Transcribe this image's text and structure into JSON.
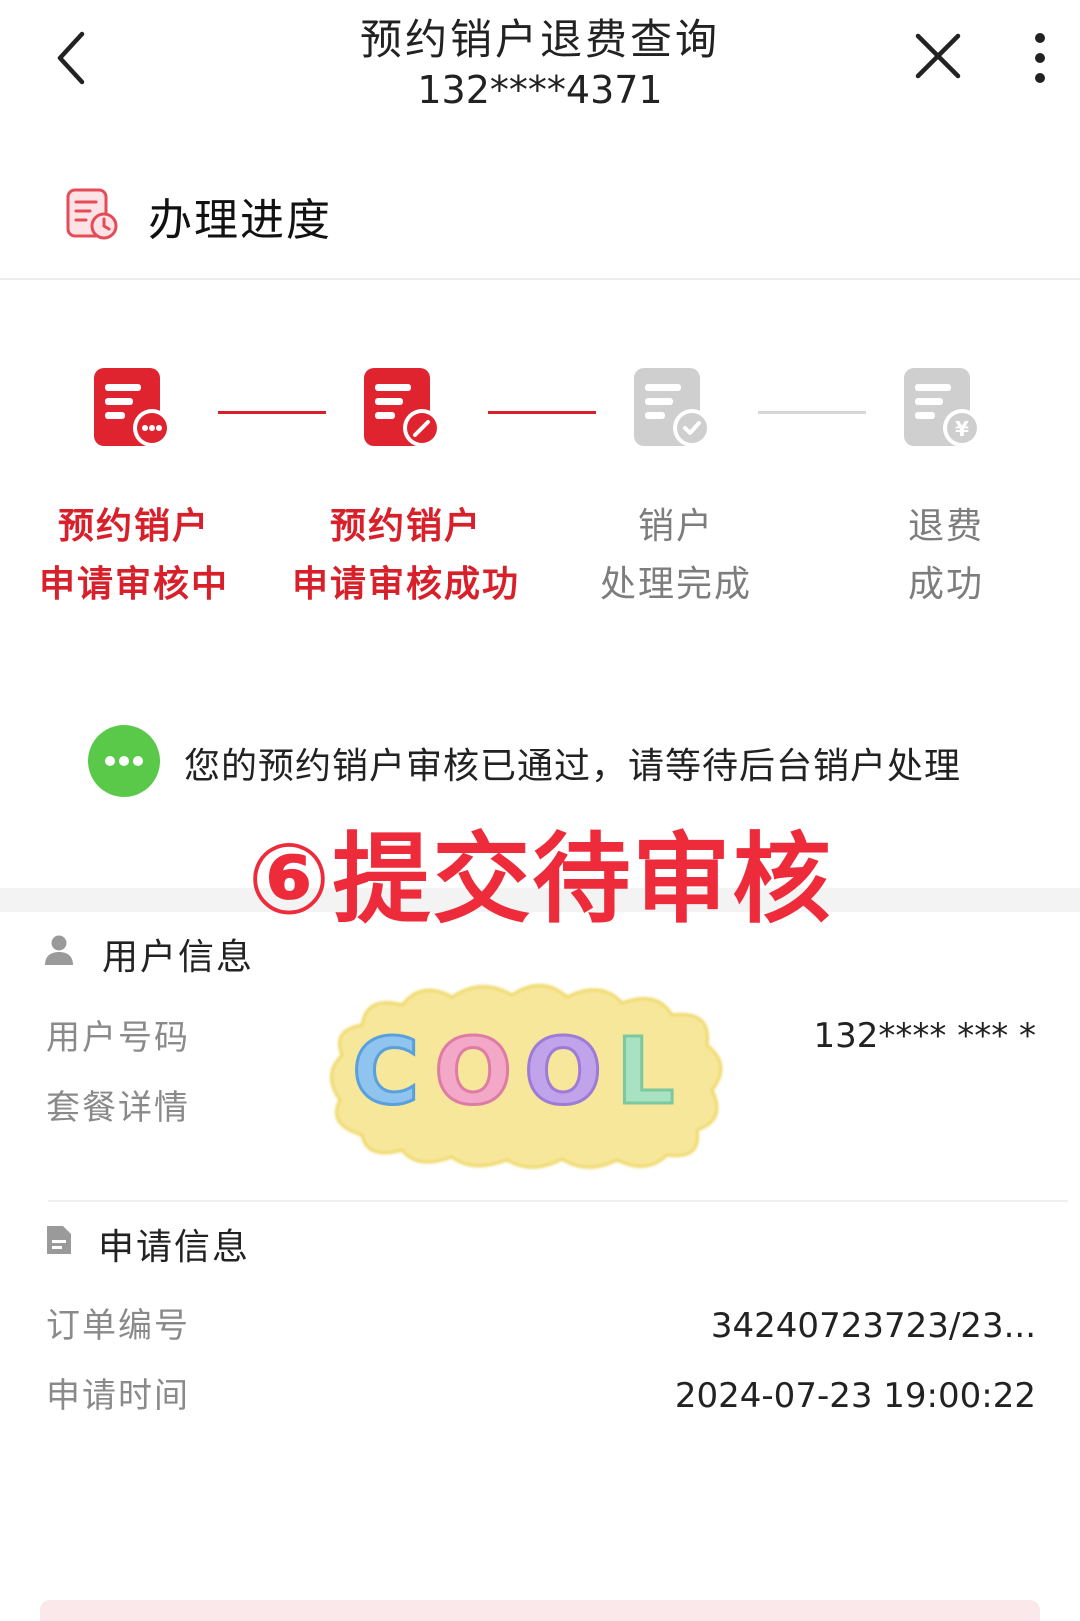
{
  "header": {
    "title": "预约销户退费查询",
    "phone": "132****4371"
  },
  "progress": {
    "section_title": "办理进度",
    "steps": [
      {
        "line1": "预约销户",
        "line2": "申请审核中",
        "state": "active"
      },
      {
        "line1": "预约销户",
        "line2": "申请审核成功",
        "state": "active"
      },
      {
        "line1": "销户",
        "line2": "处理完成",
        "state": "inactive"
      },
      {
        "line1": "退费",
        "line2": "成功",
        "state": "inactive"
      }
    ],
    "status_message": "您的预约销户审核已通过，请等待后台销户处理"
  },
  "overlay": {
    "caption": "⑥提交待审核",
    "sticker_text": "COOL"
  },
  "user_info": {
    "title": "用户信息",
    "rows": [
      {
        "label": "用户号码",
        "value": "132**** *** *"
      },
      {
        "label": "套餐详情",
        "value": ""
      }
    ]
  },
  "application_info": {
    "title": "申请信息",
    "rows": [
      {
        "label": "订单编号",
        "value": "34240723723/23..."
      },
      {
        "label": "申请时间",
        "value": "2024-07-23 19:00:22"
      }
    ]
  },
  "colors": {
    "accent": "#d8202b",
    "inactive": "#c8c8c8",
    "status_green": "#5ac94a",
    "overlay_red": "#ee2b3a"
  }
}
